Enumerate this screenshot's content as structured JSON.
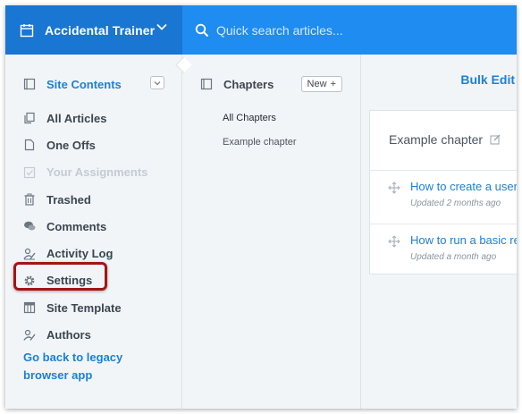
{
  "header": {
    "site_name": "Accidental Trainer",
    "search_placeholder": "Quick search articles..."
  },
  "sidebar": {
    "section_title": "Site Contents",
    "items": [
      {
        "label": "All Articles"
      },
      {
        "label": "One Offs"
      },
      {
        "label": "Your Assignments"
      },
      {
        "label": "Trashed"
      },
      {
        "label": "Comments"
      },
      {
        "label": "Activity Log"
      },
      {
        "label": "Settings"
      },
      {
        "label": "Site Template"
      },
      {
        "label": "Authors"
      }
    ],
    "legacy_link": "Go back to legacy browser app"
  },
  "chapters": {
    "title": "Chapters",
    "new_label": "New",
    "items": [
      {
        "label": "All Chapters"
      },
      {
        "label": "Example chapter"
      }
    ]
  },
  "main": {
    "bulk_edit": "Bulk Edit",
    "chapter_title": "Example chapter",
    "articles": [
      {
        "title": "How to create a user",
        "meta": "Updated 2 months ago"
      },
      {
        "title": "How to run a basic re",
        "meta": "Updated a month ago"
      }
    ]
  }
}
